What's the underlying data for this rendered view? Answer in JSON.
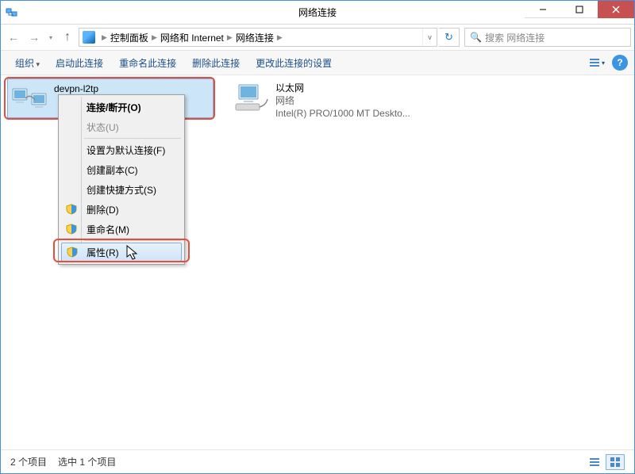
{
  "window": {
    "title": "网络连接"
  },
  "breadcrumb": {
    "items": [
      "控制面板",
      "网络和 Internet",
      "网络连接"
    ]
  },
  "search": {
    "placeholder": "搜索 网络连接"
  },
  "toolbar": {
    "organize": "组织",
    "start": "启动此连接",
    "rename": "重命名此连接",
    "delete": "删除此连接",
    "change_settings": "更改此连接的设置"
  },
  "connections": [
    {
      "name": "devpn-l2tp",
      "sub1": "",
      "sub2": "",
      "selected": true
    },
    {
      "name": "以太网",
      "sub1": "网络",
      "sub2": "Intel(R) PRO/1000 MT Deskto...",
      "selected": false
    }
  ],
  "context_menu": {
    "items": [
      {
        "label": "连接/断开(O)",
        "bold": true
      },
      {
        "label": "状态(U)",
        "disabled": true
      },
      {
        "sep": true
      },
      {
        "label": "设置为默认连接(F)"
      },
      {
        "label": "创建副本(C)"
      },
      {
        "label": "创建快捷方式(S)"
      },
      {
        "label": "删除(D)",
        "shield": true
      },
      {
        "label": "重命名(M)",
        "shield": true
      },
      {
        "sep": true
      },
      {
        "label": "属性(R)",
        "shield": true,
        "hover": true
      }
    ]
  },
  "statusbar": {
    "count": "2 个项目",
    "selection": "选中 1 个项目"
  }
}
